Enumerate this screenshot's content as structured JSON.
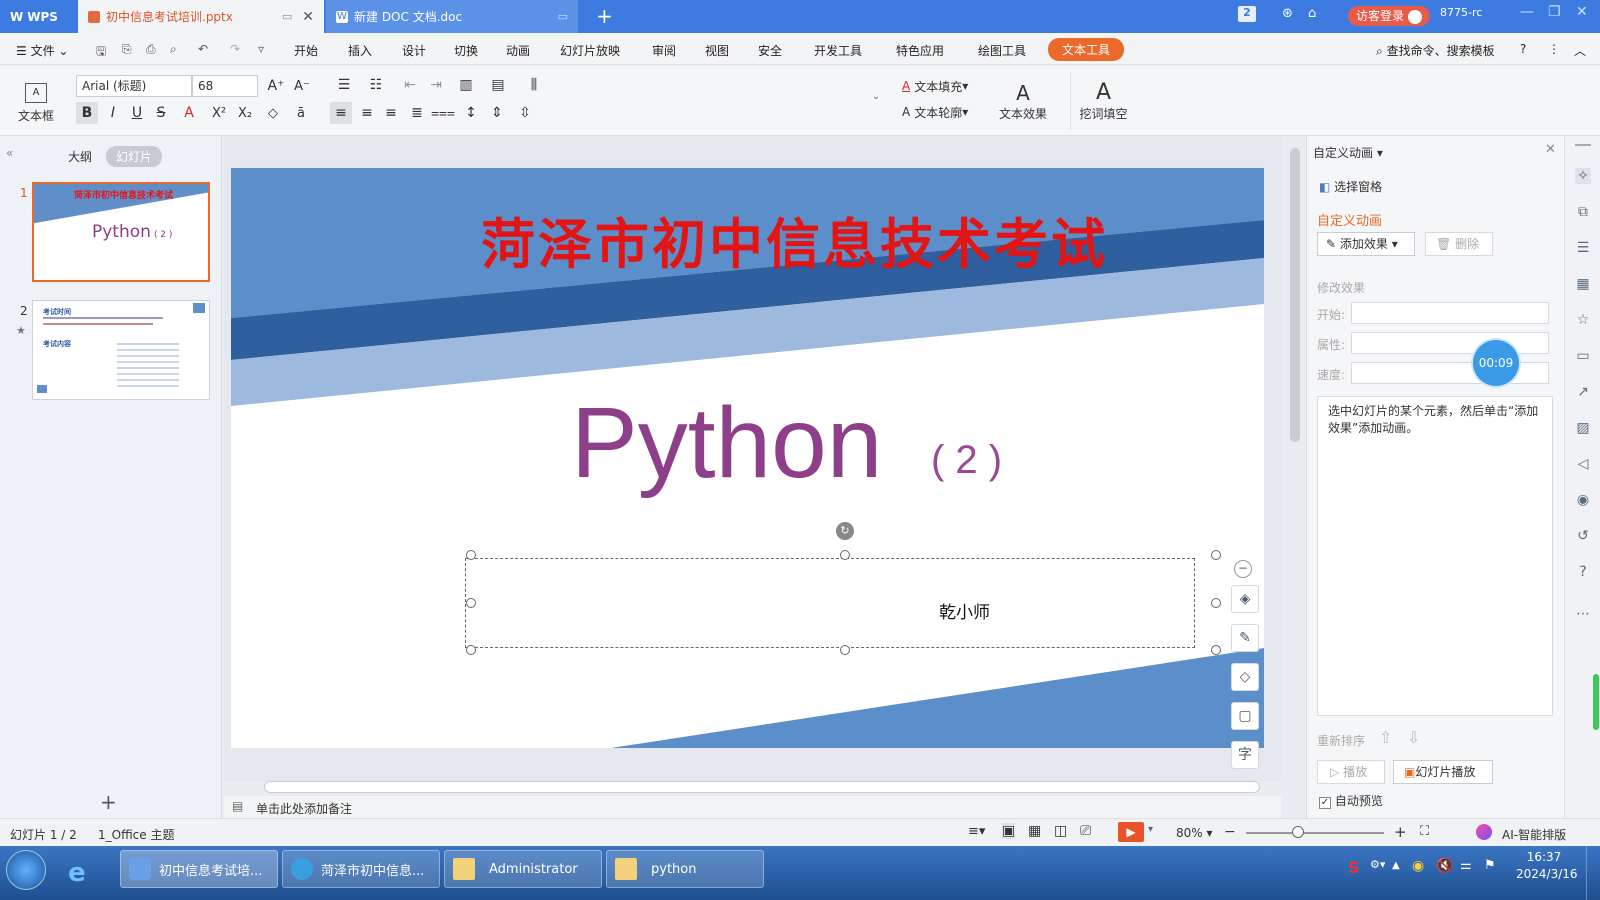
{
  "titlebar": {
    "wps_label": "WPS",
    "active_tab": "初中信息考试培训.pptx",
    "doc_tab": "新建 DOC 文档.doc",
    "badge": "2",
    "login": "访客登录",
    "user": "8775-rc"
  },
  "menu": {
    "file": "文件",
    "items": [
      "开始",
      "插入",
      "设计",
      "切换",
      "动画",
      "幻灯片放映",
      "审阅",
      "视图",
      "安全",
      "开发工具",
      "特色应用",
      "绘图工具"
    ],
    "active": "文本工具",
    "search": "查找命令、搜索模板"
  },
  "ribbon": {
    "textbox": "文本框",
    "font": "Arial (标题)",
    "size": "68",
    "fill": "文本填充",
    "outline": "文本轮廓",
    "effect": "文本效果",
    "cloze": "挖词填空",
    "wordart_glyph": "A"
  },
  "leftpane": {
    "tab_outline": "大纲",
    "tab_slides": "幻灯片",
    "slide1_num": "1",
    "slide1_title": "菏泽市初中信息技术考试",
    "slide1_sub": "Python",
    "slide1_sub2": "( 2 )",
    "slide2_num": "2",
    "slide2_head1": "考试时间",
    "slide2_head2": "考试内容"
  },
  "slide": {
    "title": "菏泽市初中信息技术考试",
    "main": "Python",
    "suffix": "( 2 )",
    "author": "乾小师"
  },
  "notes": "单击此处添加备注",
  "panel": {
    "title": "自定义动画",
    "select_pane": "选择窗格",
    "section": "自定义动画",
    "add_effect": "添加效果",
    "delete": "删除",
    "modify": "修改效果",
    "start": "开始:",
    "property": "属性:",
    "speed": "速度:",
    "hint": "选中幻灯片的某个元素，然后单击“添加效果”添加动画。",
    "reorder": "重新排序",
    "play": "播放",
    "slideshow": "幻灯片播放",
    "autopreview": "自动预览",
    "timer": "00:09"
  },
  "status": {
    "slide_info": "幻灯片 1 / 2",
    "theme": "1_Office 主题",
    "zoom": "80%",
    "ai": "AI-智能排版"
  },
  "taskbar": {
    "items": [
      "初中信息考试培...",
      "菏泽市初中信息...",
      "Administrator",
      "python"
    ],
    "time": "16:37",
    "date": "2024/3/16"
  }
}
